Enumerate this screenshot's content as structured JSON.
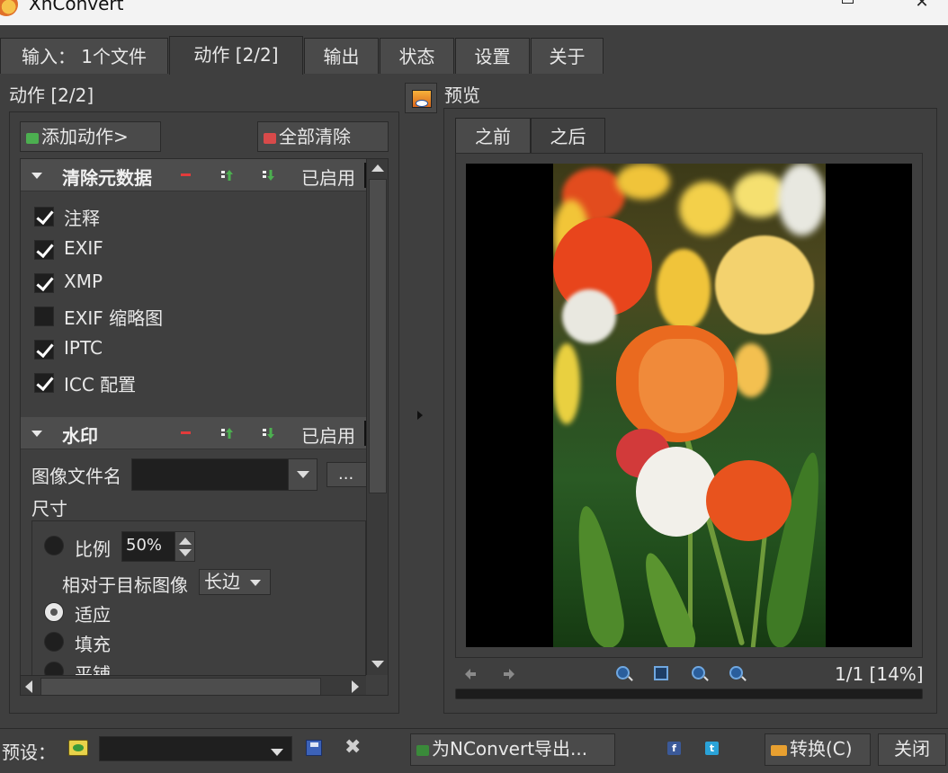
{
  "window": {
    "title": "XnConvert",
    "minimize": "—",
    "close": "✕"
  },
  "tabs": [
    {
      "label": "输入：  1个文件"
    },
    {
      "label": "动作 [2/2]"
    },
    {
      "label": "输出"
    },
    {
      "label": "状态"
    },
    {
      "label": "设置"
    },
    {
      "label": "关于"
    }
  ],
  "actions": {
    "section_title": "动作 [2/2]",
    "add_action": "添加动作>",
    "clear_all": "全部清除",
    "groups": [
      {
        "name": "清除元数据",
        "enabled_label": "已启用",
        "items": [
          {
            "label": "注释",
            "checked": true
          },
          {
            "label": "EXIF",
            "checked": true
          },
          {
            "label": "XMP",
            "checked": true
          },
          {
            "label": "EXIF 缩略图",
            "checked": false
          },
          {
            "label": "IPTC",
            "checked": true
          },
          {
            "label": "ICC 配置",
            "checked": true
          }
        ]
      },
      {
        "name": "水印",
        "enabled_label": "已启用",
        "image_filename_label": "图像文件名",
        "image_filename_value": "",
        "browse_label": "...",
        "size_label": "尺寸",
        "ratio_label": "比例",
        "ratio_value": "50%",
        "relative_label": "相对于目标图像",
        "relative_value": "长边",
        "fit_label": "适应",
        "fill_label": "填充",
        "tile_label": "平铺",
        "selected_size_mode": "适应"
      }
    ]
  },
  "preview": {
    "title": "预览",
    "tabs": [
      {
        "label": "之前"
      },
      {
        "label": "之后"
      }
    ],
    "active_tab": "之后",
    "page_info": "1/1 [14%]"
  },
  "bottom": {
    "preset_label": "预设：",
    "preset_value": "",
    "export_label": "为NConvert导出...",
    "convert_label": "转换(C)",
    "close_label": "关闭"
  },
  "colors": {
    "background": "#3f3f3f",
    "panel": "#4a4a4a",
    "field": "#1f1f1f",
    "text": "#e8e8e8"
  },
  "icons": {
    "add": "add-action-icon",
    "clear": "clear-all-icon",
    "remove": "remove-icon",
    "move_up": "move-up-icon",
    "move_down": "move-down-icon",
    "facebook": "facebook-icon",
    "twitter": "twitter-icon"
  }
}
